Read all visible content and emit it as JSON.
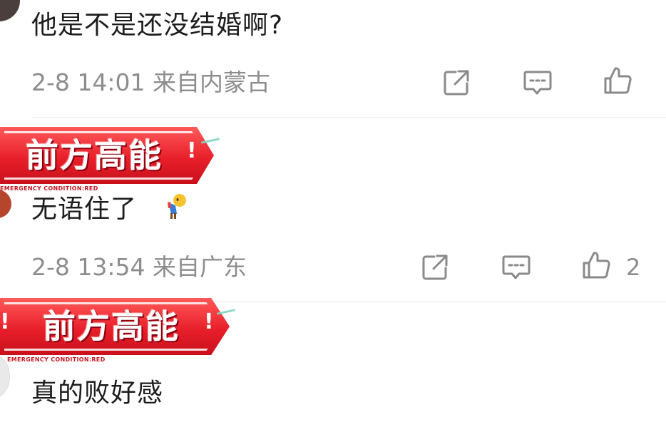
{
  "comments": [
    {
      "text": "他是不是还没结婚啊?",
      "time": "2-8 14:01",
      "location": "来自内蒙古",
      "like_count": ""
    },
    {
      "badge_title": "前方高能",
      "badge_mark": "!",
      "badge_sub": "EMERGENCY CONDITION:RED",
      "text": "无语住了",
      "emoji": "person-bowing-emoji",
      "time": "2-8 13:54",
      "location": "来自广东",
      "like_count": "2"
    },
    {
      "badge_title": "前方高能",
      "badge_mark": "!",
      "badge_sub": "EMERGENCY CONDITION:RED",
      "text": "真的败好感"
    }
  ],
  "icons": {
    "share": "share-icon",
    "reply": "comment-icon",
    "like": "thumbs-up-icon"
  },
  "colors": {
    "meta_text": "#8d8d8d",
    "badge_red": "#e81f2a",
    "divider": "#ececec"
  }
}
